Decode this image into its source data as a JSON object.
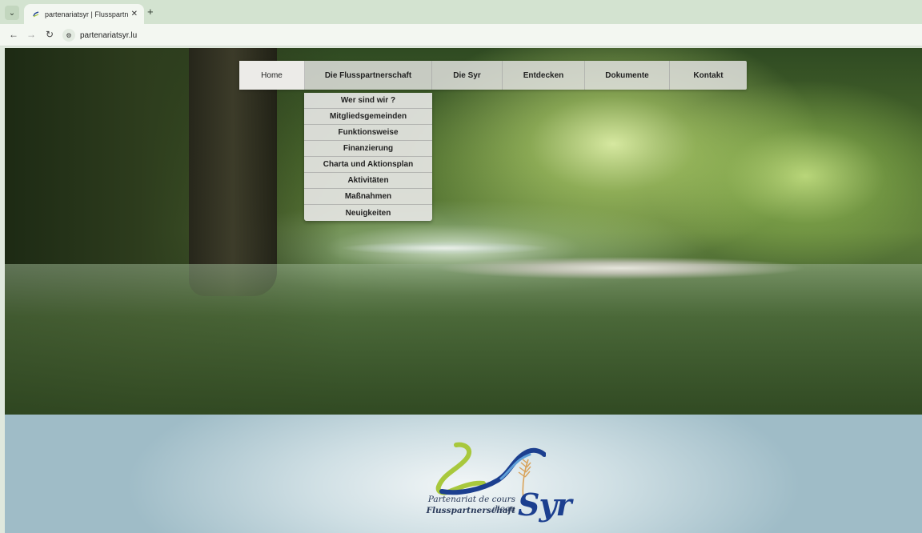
{
  "browser": {
    "tab_title": "partenariatsyr | Flusspartnersch",
    "url": "partenariatsyr.lu"
  },
  "nav": {
    "items": [
      {
        "label": "Home",
        "active": true
      },
      {
        "label": "Die Flusspartnerschaft"
      },
      {
        "label": "Die Syr"
      },
      {
        "label": "Entdecken"
      },
      {
        "label": "Dokumente"
      },
      {
        "label": "Kontakt"
      }
    ],
    "dropdown": [
      "Wer sind wir ?",
      "Mitgliedsgemeinden",
      "Funktionsweise",
      "Finanzierung",
      "Charta und Aktionsplan",
      "Aktivitäten",
      "Maßnahmen",
      "Neuigkeiten"
    ]
  },
  "logo": {
    "tagline": "Partenariat de cours d'eau",
    "subtitle": "Flusspartnerschaft",
    "name": "Syr"
  },
  "colors": {
    "logo_blue": "#1c3f8f",
    "logo_green": "#a8c83c",
    "logo_wheat": "#d9a35a"
  }
}
